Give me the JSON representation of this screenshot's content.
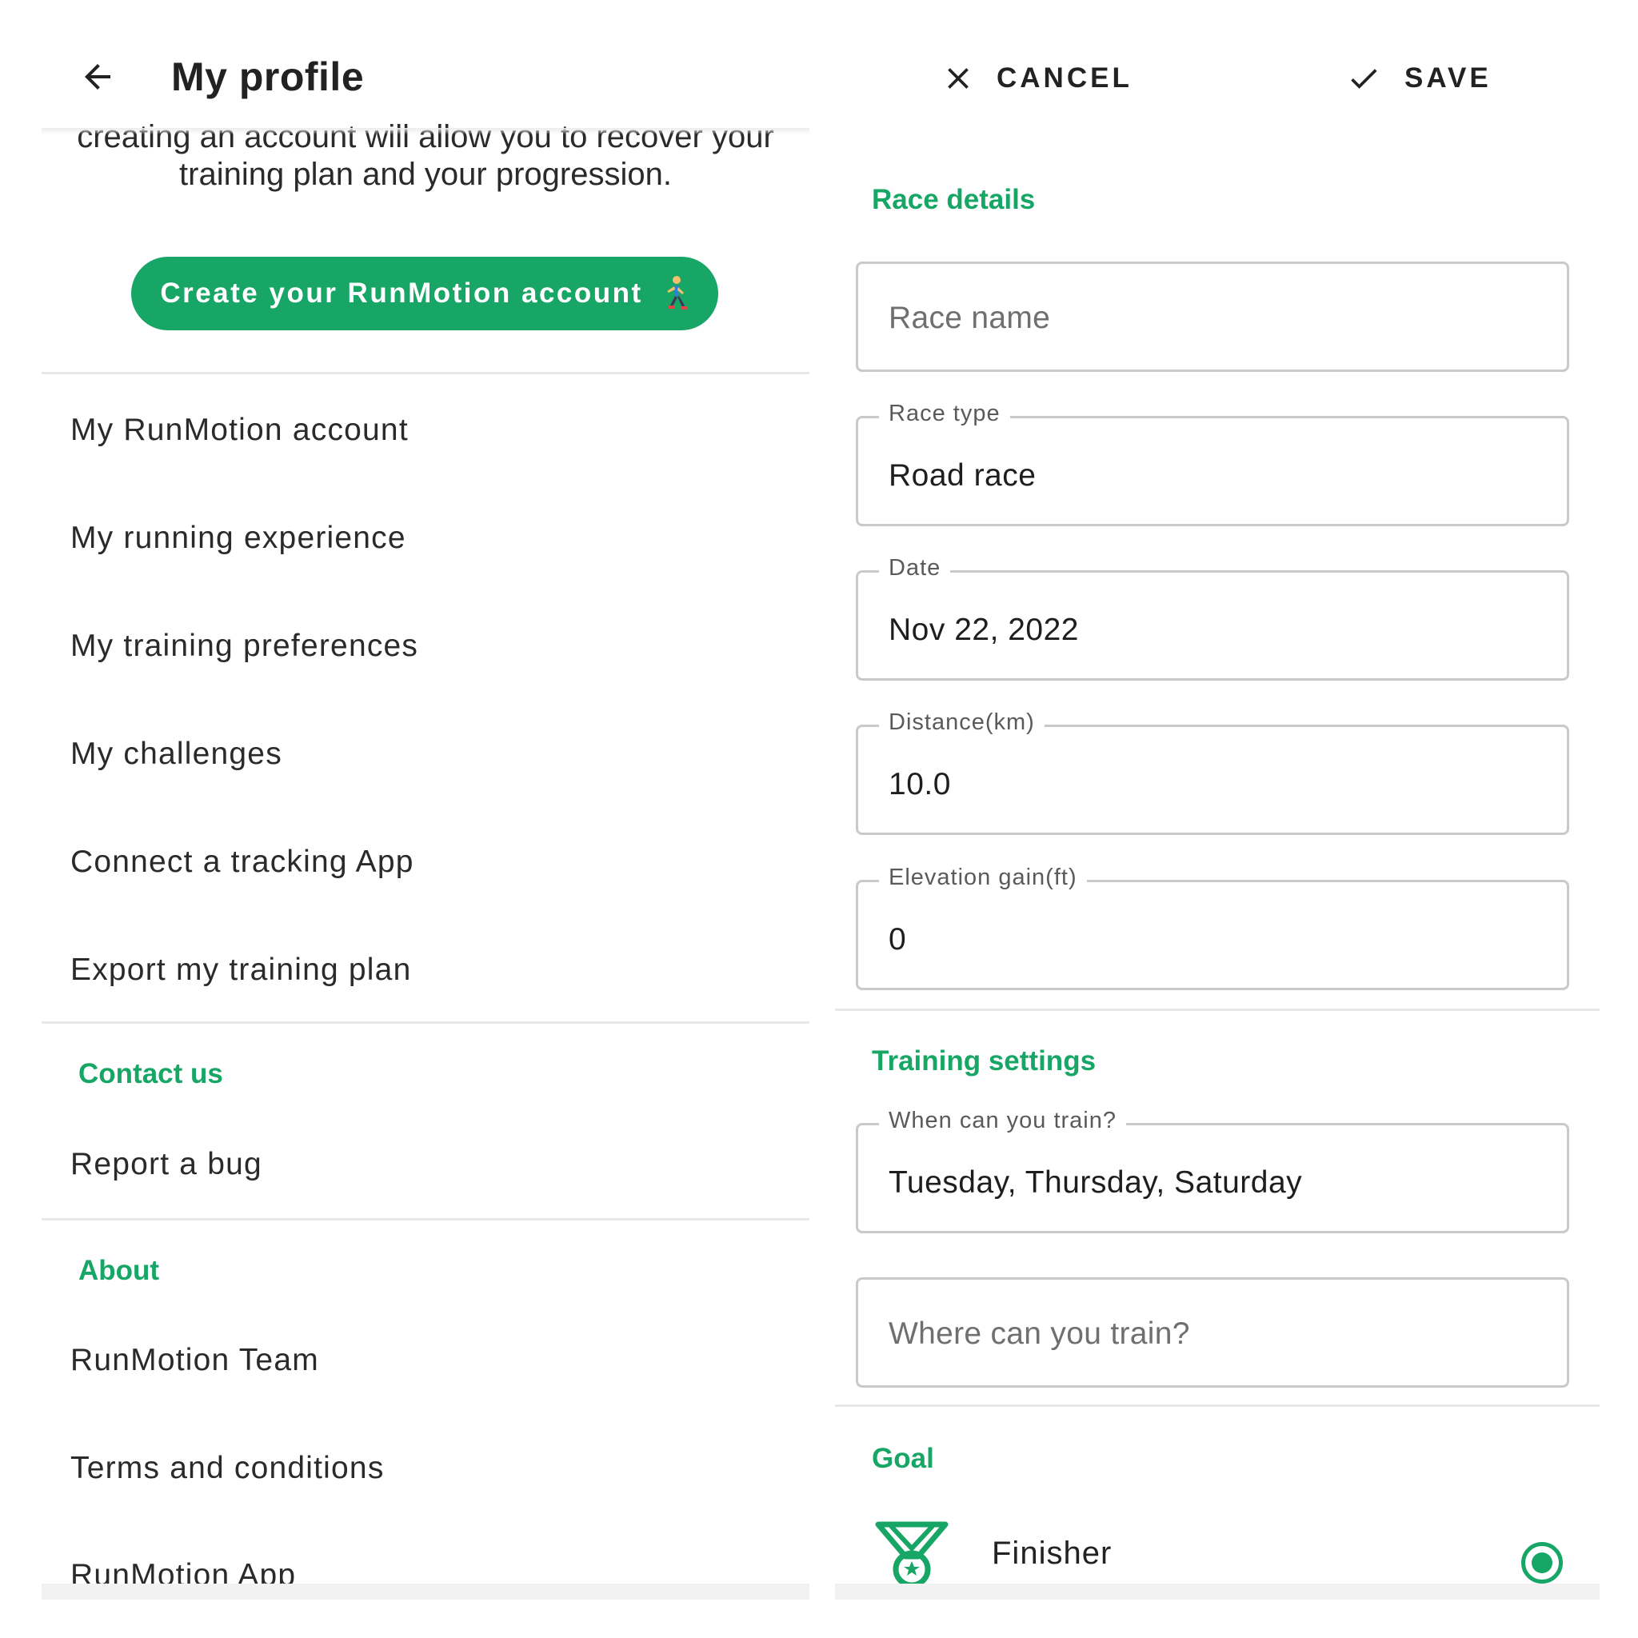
{
  "profile": {
    "title": "My profile",
    "intro_text": "creating an account will allow you to recover your training plan and your progression.",
    "create_account_label": "Create your RunMotion account",
    "menu": [
      {
        "label": "My RunMotion account"
      },
      {
        "label": "My running experience"
      },
      {
        "label": "My training preferences"
      },
      {
        "label": "My challenges"
      },
      {
        "label": "Connect a tracking App"
      },
      {
        "label": "Export my training plan"
      }
    ],
    "contact": {
      "heading": "Contact us",
      "items": [
        {
          "label": "Report a bug"
        }
      ]
    },
    "about": {
      "heading": "About",
      "items": [
        {
          "label": "RunMotion Team"
        },
        {
          "label": "Terms and conditions"
        },
        {
          "label": "RunMotion App"
        }
      ]
    }
  },
  "race_form": {
    "cancel_label": "CANCEL",
    "save_label": "SAVE",
    "race_details_heading": "Race details",
    "race_name_placeholder": "Race name",
    "race_type": {
      "label": "Race type",
      "value": "Road race"
    },
    "date": {
      "label": "Date",
      "value": "Nov 22, 2022"
    },
    "distance": {
      "label": "Distance(km)",
      "value": "10.0"
    },
    "elevation": {
      "label": "Elevation gain(ft)",
      "value": "0"
    },
    "training_heading": "Training settings",
    "when_train": {
      "label": "When can you train?",
      "value": "Tuesday, Thursday, Saturday"
    },
    "where_train_placeholder": "Where can you train?",
    "goal_heading": "Goal",
    "goal_option": {
      "label": "Finisher",
      "selected": true
    }
  },
  "colors": {
    "accent": "#17a665",
    "divider": "#e8e8e8",
    "field_border": "#c9c9c9"
  },
  "icons": [
    "back-arrow-icon",
    "runner-icon",
    "close-icon",
    "check-icon",
    "medal-icon"
  ]
}
